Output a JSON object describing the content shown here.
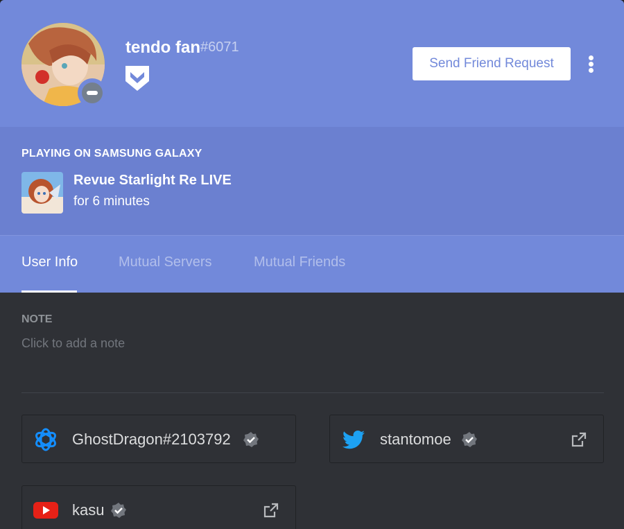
{
  "profile": {
    "username": "tendo fan",
    "discriminator": "#6071",
    "status": "do-not-disturb",
    "badge_icon": "hypesquad-badge-icon",
    "friend_button_label": "Send Friend Request",
    "more_icon": "more-vertical-icon"
  },
  "activity": {
    "heading": "PLAYING ON SAMSUNG GALAXY",
    "game_name": "Revue Starlight Re LIVE",
    "elapsed": "for 6 minutes"
  },
  "tabs": [
    {
      "label": "User Info",
      "active": true
    },
    {
      "label": "Mutual Servers",
      "active": false
    },
    {
      "label": "Mutual Friends",
      "active": false
    }
  ],
  "note": {
    "label": "NOTE",
    "placeholder": "Click to add a note"
  },
  "connected_accounts": [
    {
      "service": "battlenet",
      "icon": "battlenet-icon",
      "name": "GhostDragon#2103792",
      "verified": true,
      "external_link": false
    },
    {
      "service": "twitter",
      "icon": "twitter-icon",
      "name": "stantomoe",
      "verified": true,
      "external_link": true
    },
    {
      "service": "youtube",
      "icon": "youtube-icon",
      "name": "kasu",
      "verified": true,
      "external_link": true
    }
  ],
  "colors": {
    "blurple": "#7289da",
    "dark_bg": "#2f3136",
    "twitter": "#1da1f2",
    "youtube": "#e62117",
    "battlenet": "#148eff"
  }
}
